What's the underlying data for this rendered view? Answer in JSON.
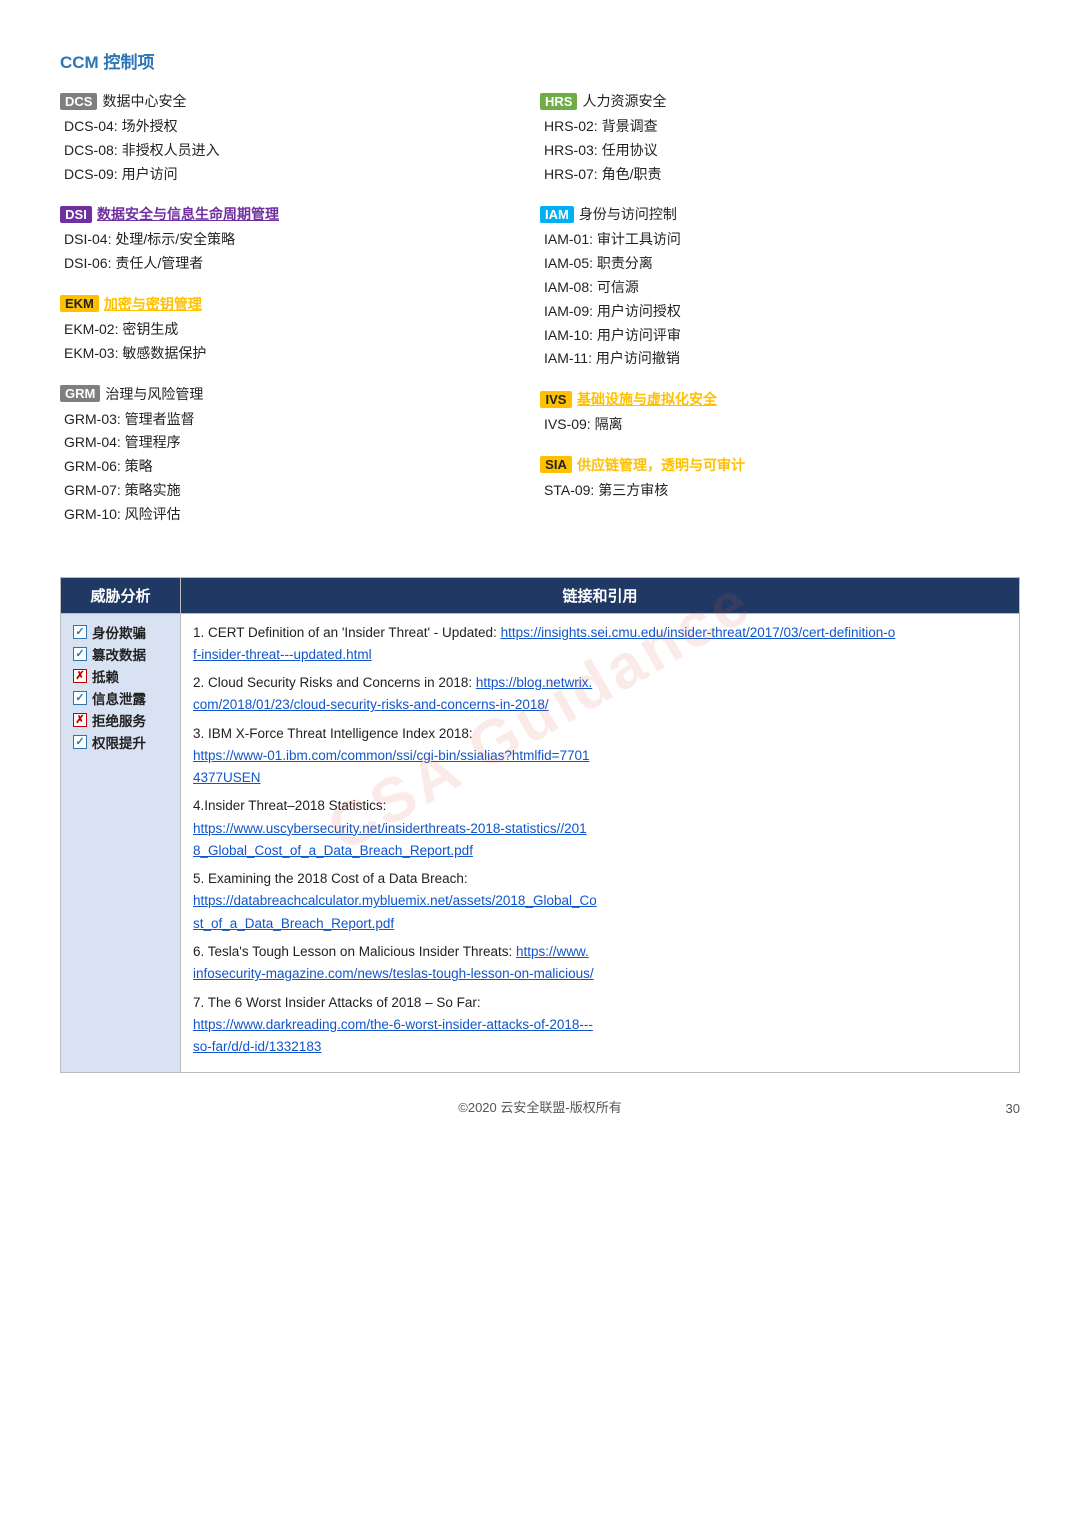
{
  "page": {
    "title": "CCM 控制项",
    "footer": "©2020 云安全联盟-版权所有",
    "page_number": "30",
    "watermark": "CSA Guidance"
  },
  "left_col": {
    "groups": [
      {
        "id": "dcs",
        "badge": "DCS",
        "badge_class": "badge-dcs",
        "label": "数据中心安全",
        "label_class": "group-label",
        "items": [
          "DCS-04:  场外授权",
          "DCS-08:  非授权人员进入",
          "DCS-09:  用户访问"
        ]
      },
      {
        "id": "dsi",
        "badge": "DSI",
        "badge_class": "badge-dsi",
        "label": "数据安全与信息生命周期管理",
        "label_class": "group-label-dsi",
        "items": [
          "DSI-04:  处理/标示/安全策略",
          "DSI-06:  责任人/管理者"
        ]
      },
      {
        "id": "ekm",
        "badge": "EKM",
        "badge_class": "badge-ekm",
        "label": "加密与密钥管理",
        "label_class": "group-label-ekm",
        "items": [
          "EKM-02:  密钥生成",
          "EKM-03:  敏感数据保护"
        ]
      },
      {
        "id": "grm",
        "badge": "GRM",
        "badge_class": "badge-dcs",
        "label": "治理与风险管理",
        "label_class": "group-label",
        "items": [
          "GRM-03:  管理者监督",
          "GRM-04:  管理程序",
          "GRM-06:  策略",
          "GRM-07:  策略实施",
          "GRM-10:  风险评估"
        ]
      }
    ]
  },
  "right_col": {
    "groups": [
      {
        "id": "hrs",
        "badge": "HRS",
        "badge_class": "badge-hrs",
        "label": "人力资源安全",
        "label_class": "group-label",
        "items": [
          "HRS-02:  背景调查",
          "HRS-03:  任用协议",
          "HRS-07:  角色/职责"
        ]
      },
      {
        "id": "iam",
        "badge": "IAM",
        "badge_class": "badge-iam",
        "label": "身份与访问控制",
        "label_class": "group-label",
        "items": [
          "IAM-01:  审计工具访问",
          "IAM-05:  职责分离",
          "IAM-08:  可信源",
          "IAM-09:  用户访问授权",
          "IAM-10:  用户访问评审",
          "IAM-11:  用户访问撤销"
        ]
      },
      {
        "id": "ivs",
        "badge": "IVS",
        "badge_class": "badge-ivs",
        "label": "基础设施与虚拟化安全",
        "label_class": "group-label-ivs",
        "items": [
          "IVS-09:  隔离"
        ]
      },
      {
        "id": "sta",
        "badge": "SIA",
        "badge_class": "badge-sta",
        "label": "供应链管理，透明与可审计",
        "label_class": "group-label-sta",
        "items": [
          "STA-09:  第三方审核"
        ]
      }
    ]
  },
  "table": {
    "col1_header": "威胁分析",
    "col2_header": "链接和引用",
    "threats": [
      {
        "label": "身份欺骗",
        "checked": true,
        "check_type": "blue"
      },
      {
        "label": "篡改数据",
        "checked": true,
        "check_type": "blue"
      },
      {
        "label": "抵赖",
        "checked": false,
        "check_type": "red"
      },
      {
        "label": "信息泄露",
        "checked": true,
        "check_type": "blue"
      },
      {
        "label": "拒绝服务",
        "checked": false,
        "check_type": "red"
      },
      {
        "label": "权限提升",
        "checked": true,
        "check_type": "blue"
      }
    ],
    "references": [
      {
        "number": "1",
        "text": "CERT Definition of an 'Insider Threat' - Updated: ",
        "link": "https://insights.sei.cmu.edu/insider-threat/2017/03/cert-definition-of-insider-threat---updated.html",
        "link_display": "https://insights.sei.cmu.edu/insider-threat/2017/03/cert-definition-o\nf-insider-threat---updated.html"
      },
      {
        "number": "2",
        "text": "Cloud Security Risks and Concerns in 2018: ",
        "link": "https://blog.netwrix.com/2018/01/23/cloud-security-risks-and-concerns-in-2018/",
        "link_display": "https://blog.netwrix.\ncom/2018/01/23/cloud-security-risks-and-concerns-in-2018/"
      },
      {
        "number": "3",
        "text": "IBM X-Force Threat Intelligence Index 2018: ",
        "link": "https://www-01.ibm.com/common/ssi/cgi-bin/ssialias?htmlfid=77014377USEN",
        "link_display": "https://www-01.ibm.com/common/ssi/cgi-bin/ssialias?htmlfid=7701\n4377USEN"
      },
      {
        "number": "4",
        "text": "Insider Threat–2018 Statistics: ",
        "link": "https://www.uscybersecurity.net/insiderthreats-2018-statistics//2018_Global_Cost_of_a_Data_Breach_Report.pdf",
        "link_display": "https://www.uscybersecurity.net/insiderthreats-2018-statistics//201\n8_Global_Cost_of_a_Data_Breach_Report.pdf"
      },
      {
        "number": "5",
        "text": "Examining the 2018 Cost of a Data Breach: ",
        "link": "https://databreachcalculator.mybluemix.net/assets/2018_Global_Cost_of_a_Data_Breach_Report.pdf",
        "link_display": "https://databreachcalculator.mybluemix.net/assets/2018_Global_Co\nst_of_a_Data_Breach_Report.pdf"
      },
      {
        "number": "6",
        "text": "Tesla's Tough Lesson on Malicious Insider Threats: ",
        "link": "https://www.infosecurity-magazine.com/news/teslas-tough-lesson-on-malicious/",
        "link_display": "https://www.\ninfosecurity-magazine.com/news/teslas-tough-lesson-on-malicious/"
      },
      {
        "number": "7",
        "text": "The 6 Worst Insider Attacks of 2018 – So Far: ",
        "link": "https://www.darkreading.com/the-6-worst-insider-attacks-of-2018---so-far/d/d-id/1332183",
        "link_display": "https://www.darkreading.com/the-6-worst-insider-attacks-of-2018---\nso-far/d/d-id/1332183"
      }
    ]
  }
}
